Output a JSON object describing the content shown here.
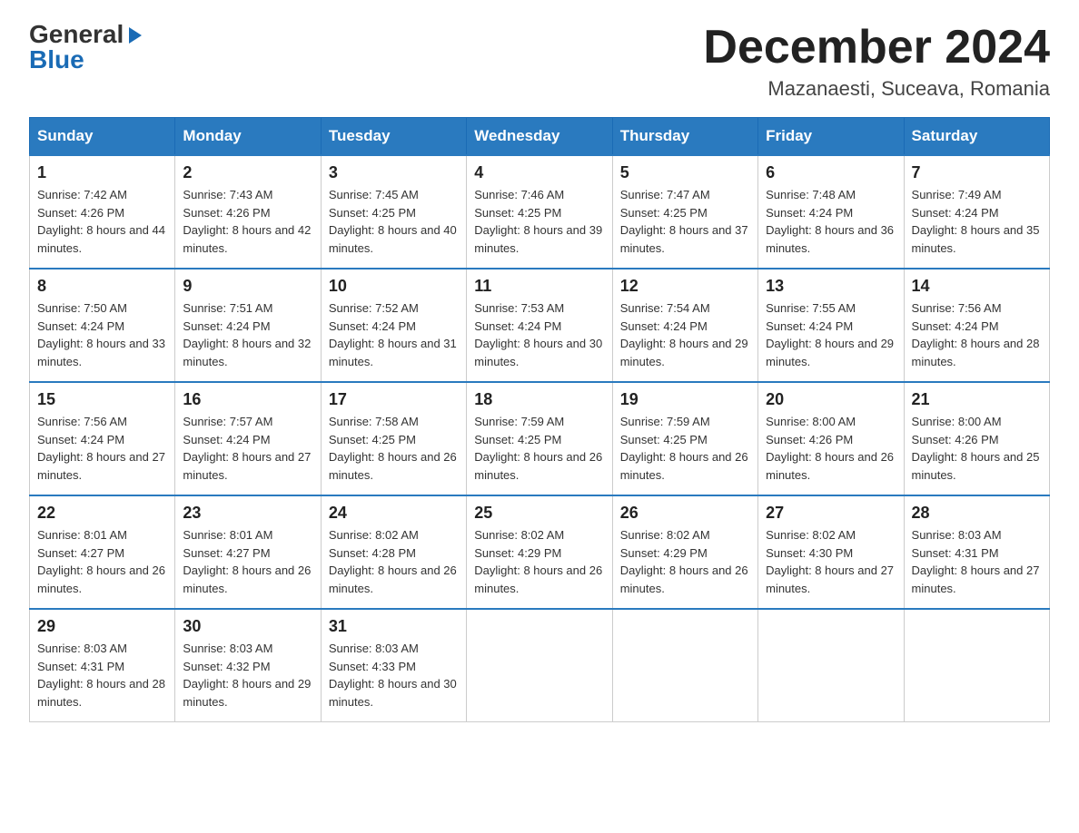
{
  "logo": {
    "general": "General",
    "blue": "Blue"
  },
  "title": "December 2024",
  "location": "Mazanaesti, Suceava, Romania",
  "weekdays": [
    "Sunday",
    "Monday",
    "Tuesday",
    "Wednesday",
    "Thursday",
    "Friday",
    "Saturday"
  ],
  "weeks": [
    [
      {
        "day": "1",
        "sunrise": "7:42 AM",
        "sunset": "4:26 PM",
        "daylight": "8 hours and 44 minutes."
      },
      {
        "day": "2",
        "sunrise": "7:43 AM",
        "sunset": "4:26 PM",
        "daylight": "8 hours and 42 minutes."
      },
      {
        "day": "3",
        "sunrise": "7:45 AM",
        "sunset": "4:25 PM",
        "daylight": "8 hours and 40 minutes."
      },
      {
        "day": "4",
        "sunrise": "7:46 AM",
        "sunset": "4:25 PM",
        "daylight": "8 hours and 39 minutes."
      },
      {
        "day": "5",
        "sunrise": "7:47 AM",
        "sunset": "4:25 PM",
        "daylight": "8 hours and 37 minutes."
      },
      {
        "day": "6",
        "sunrise": "7:48 AM",
        "sunset": "4:24 PM",
        "daylight": "8 hours and 36 minutes."
      },
      {
        "day": "7",
        "sunrise": "7:49 AM",
        "sunset": "4:24 PM",
        "daylight": "8 hours and 35 minutes."
      }
    ],
    [
      {
        "day": "8",
        "sunrise": "7:50 AM",
        "sunset": "4:24 PM",
        "daylight": "8 hours and 33 minutes."
      },
      {
        "day": "9",
        "sunrise": "7:51 AM",
        "sunset": "4:24 PM",
        "daylight": "8 hours and 32 minutes."
      },
      {
        "day": "10",
        "sunrise": "7:52 AM",
        "sunset": "4:24 PM",
        "daylight": "8 hours and 31 minutes."
      },
      {
        "day": "11",
        "sunrise": "7:53 AM",
        "sunset": "4:24 PM",
        "daylight": "8 hours and 30 minutes."
      },
      {
        "day": "12",
        "sunrise": "7:54 AM",
        "sunset": "4:24 PM",
        "daylight": "8 hours and 29 minutes."
      },
      {
        "day": "13",
        "sunrise": "7:55 AM",
        "sunset": "4:24 PM",
        "daylight": "8 hours and 29 minutes."
      },
      {
        "day": "14",
        "sunrise": "7:56 AM",
        "sunset": "4:24 PM",
        "daylight": "8 hours and 28 minutes."
      }
    ],
    [
      {
        "day": "15",
        "sunrise": "7:56 AM",
        "sunset": "4:24 PM",
        "daylight": "8 hours and 27 minutes."
      },
      {
        "day": "16",
        "sunrise": "7:57 AM",
        "sunset": "4:24 PM",
        "daylight": "8 hours and 27 minutes."
      },
      {
        "day": "17",
        "sunrise": "7:58 AM",
        "sunset": "4:25 PM",
        "daylight": "8 hours and 26 minutes."
      },
      {
        "day": "18",
        "sunrise": "7:59 AM",
        "sunset": "4:25 PM",
        "daylight": "8 hours and 26 minutes."
      },
      {
        "day": "19",
        "sunrise": "7:59 AM",
        "sunset": "4:25 PM",
        "daylight": "8 hours and 26 minutes."
      },
      {
        "day": "20",
        "sunrise": "8:00 AM",
        "sunset": "4:26 PM",
        "daylight": "8 hours and 26 minutes."
      },
      {
        "day": "21",
        "sunrise": "8:00 AM",
        "sunset": "4:26 PM",
        "daylight": "8 hours and 25 minutes."
      }
    ],
    [
      {
        "day": "22",
        "sunrise": "8:01 AM",
        "sunset": "4:27 PM",
        "daylight": "8 hours and 26 minutes."
      },
      {
        "day": "23",
        "sunrise": "8:01 AM",
        "sunset": "4:27 PM",
        "daylight": "8 hours and 26 minutes."
      },
      {
        "day": "24",
        "sunrise": "8:02 AM",
        "sunset": "4:28 PM",
        "daylight": "8 hours and 26 minutes."
      },
      {
        "day": "25",
        "sunrise": "8:02 AM",
        "sunset": "4:29 PM",
        "daylight": "8 hours and 26 minutes."
      },
      {
        "day": "26",
        "sunrise": "8:02 AM",
        "sunset": "4:29 PM",
        "daylight": "8 hours and 26 minutes."
      },
      {
        "day": "27",
        "sunrise": "8:02 AM",
        "sunset": "4:30 PM",
        "daylight": "8 hours and 27 minutes."
      },
      {
        "day": "28",
        "sunrise": "8:03 AM",
        "sunset": "4:31 PM",
        "daylight": "8 hours and 27 minutes."
      }
    ],
    [
      {
        "day": "29",
        "sunrise": "8:03 AM",
        "sunset": "4:31 PM",
        "daylight": "8 hours and 28 minutes."
      },
      {
        "day": "30",
        "sunrise": "8:03 AM",
        "sunset": "4:32 PM",
        "daylight": "8 hours and 29 minutes."
      },
      {
        "day": "31",
        "sunrise": "8:03 AM",
        "sunset": "4:33 PM",
        "daylight": "8 hours and 30 minutes."
      },
      null,
      null,
      null,
      null
    ]
  ]
}
